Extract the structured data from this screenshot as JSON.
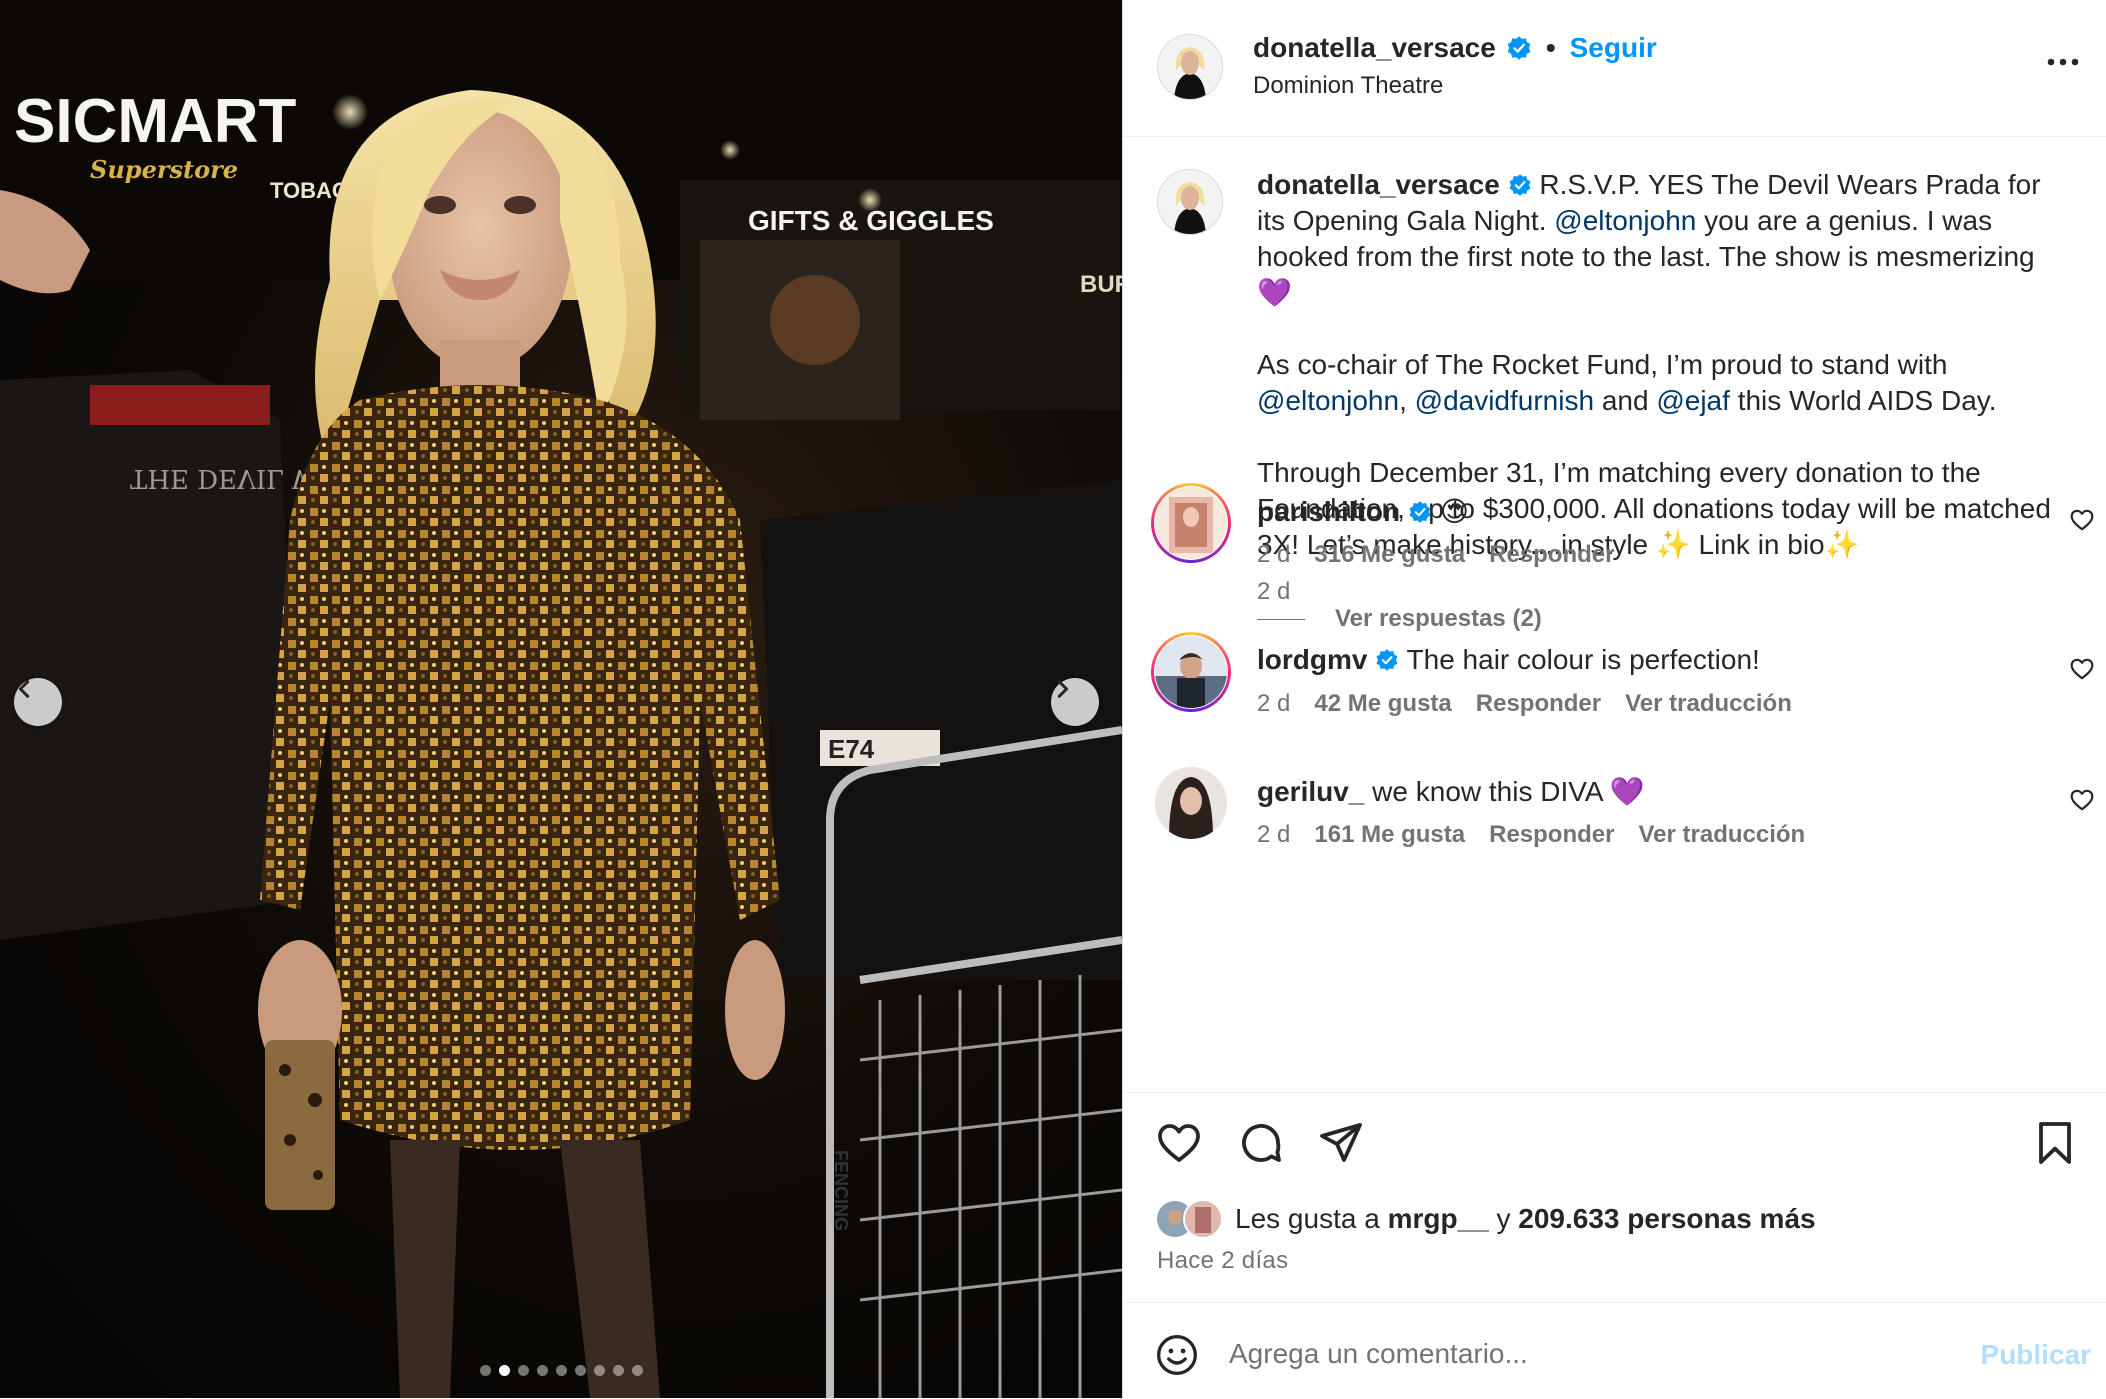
{
  "photo": {
    "signs": {
      "store_main": "SICMART",
      "store_sub": "Superstore",
      "tobacco": "TOBACCO-VAPE",
      "gifts": "GIFTS & GIGGLES",
      "burger": "BUR",
      "bus_text": "THE DEVIL WEARS PRADA",
      "plate": "E74",
      "fencing": "FENCING"
    },
    "carousel": {
      "total": 9,
      "active": 1
    }
  },
  "header": {
    "username": "donatella_versace",
    "separator": "•",
    "follow_label": "Seguir",
    "location": "Dominion Theatre"
  },
  "caption": {
    "username": "donatella_versace",
    "p1_a": "R.S.V.P. YES The Devil Wears Prada for its Opening Gala Night.",
    "p1_mention": "@eltonjohn",
    "p1_b": "you are a genius. I was hooked from the first note to the last. The show is mesmerizing 💜",
    "p2_a": "As co-chair of The Rocket Fund, I’m proud to stand with",
    "p2_m1": "@eltonjohn",
    "p2_sep": ",",
    "p2_m2": "@davidfurnish",
    "p2_and": "and",
    "p2_m3": "@ejaf",
    "p2_b": "this World AIDS Day.",
    "p3": "Through December 31, I’m matching every donation to the Foundation, up to $300,000. All donations today will be matched 3X! Let’s make history....in style ✨ Link in bio✨",
    "time": "2 d"
  },
  "comments": [
    {
      "username": "parishilton",
      "text": "😍",
      "time": "2 d",
      "likes": "316 Me gusta",
      "reply": "Responder",
      "view_replies": "Ver respuestas (2)"
    },
    {
      "username": "lordgmv",
      "text": "The hair colour is perfection!",
      "time": "2 d",
      "likes": "42 Me gusta",
      "reply": "Responder",
      "translate": "Ver traducción"
    },
    {
      "username": "geriluv_",
      "text": "we know this DIVA 💜",
      "time": "2 d",
      "likes": "161 Me gusta",
      "reply": "Responder",
      "translate": "Ver traducción"
    }
  ],
  "likes": {
    "prefix": "Les gusta a",
    "user": "mrgp__",
    "conj": "y",
    "others": "209.633 personas más"
  },
  "post_time": "Hace 2 días",
  "add_comment": {
    "placeholder": "Agrega un comentario...",
    "publish_label": "Publicar"
  },
  "colors": {
    "accent": "#0095f6",
    "mention": "#00376b",
    "muted": "#737373",
    "publish_disabled": "#b2dffc",
    "verified": "#0095f6"
  },
  "icons": {
    "more": "more-horizontal-icon",
    "verified": "verified-badge-icon",
    "heart": "heart-icon",
    "comment": "comment-icon",
    "share": "share-icon",
    "save": "bookmark-icon",
    "emoji": "emoji-icon",
    "prev": "chevron-left-icon",
    "next": "chevron-right-icon"
  }
}
